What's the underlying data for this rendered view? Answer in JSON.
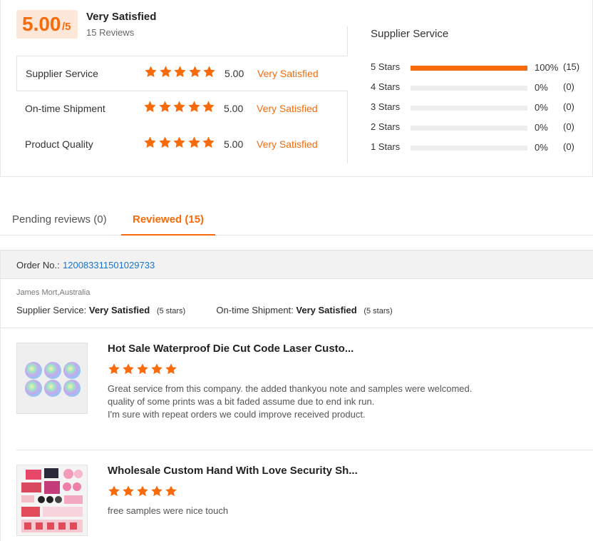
{
  "summary": {
    "score": "5.00",
    "score_max": "/5",
    "overall_label": "Very Satisfied",
    "review_count": "15 Reviews",
    "categories": [
      {
        "label": "Supplier Service",
        "stars": 5,
        "score": "5.00",
        "verdict": "Very Satisfied"
      },
      {
        "label": "On-time Shipment",
        "stars": 5,
        "score": "5.00",
        "verdict": "Very Satisfied"
      },
      {
        "label": "Product Quality",
        "stars": 5,
        "score": "5.00",
        "verdict": "Very Satisfied"
      }
    ]
  },
  "distribution": {
    "title": "Supplier Service",
    "rows": [
      {
        "label": "5  Stars",
        "fraction": 1.0,
        "pct": "100%",
        "count": "(15)"
      },
      {
        "label": "4  Stars",
        "fraction": 0.0,
        "pct": "0%",
        "count": "(0)"
      },
      {
        "label": "3  Stars",
        "fraction": 0.0,
        "pct": "0%",
        "count": "(0)"
      },
      {
        "label": "2  Stars",
        "fraction": 0.0,
        "pct": "0%",
        "count": "(0)"
      },
      {
        "label": "1  Stars",
        "fraction": 0.0,
        "pct": "0%",
        "count": "(0)"
      }
    ]
  },
  "tabs": [
    {
      "label": "Pending reviews (0)",
      "active": false
    },
    {
      "label": "Reviewed (15)",
      "active": true
    }
  ],
  "order": {
    "label": "Order No.:",
    "number": "120083311501029733",
    "reviewer": "James Mort,Australia",
    "supplier_label": "Supplier Service:",
    "supplier_value": "Very Satisfied",
    "supplier_stars": "(5 stars)",
    "shipment_label": "On-time Shipment:",
    "shipment_value": "Very Satisfied",
    "shipment_stars": "(5 stars)"
  },
  "products": [
    {
      "title": "Hot Sale Waterproof Die Cut Code Laser Custo...",
      "stars": 5,
      "review_lines": [
        "Great service from this company. the added thankyou note and samples were welcomed.",
        "quality of some prints was a bit faded assume due to end ink run.",
        "I'm sure with repeat orders we could improve received product."
      ]
    },
    {
      "title": "Wholesale Custom Hand With Love Security Sh...",
      "stars": 5,
      "review_lines": [
        "free samples were nice touch"
      ]
    }
  ],
  "colors": {
    "accent": "#f76b0c",
    "link": "#1a73c8",
    "score_bg": "#fde7d8"
  },
  "icons": {
    "star": "star-icon"
  }
}
